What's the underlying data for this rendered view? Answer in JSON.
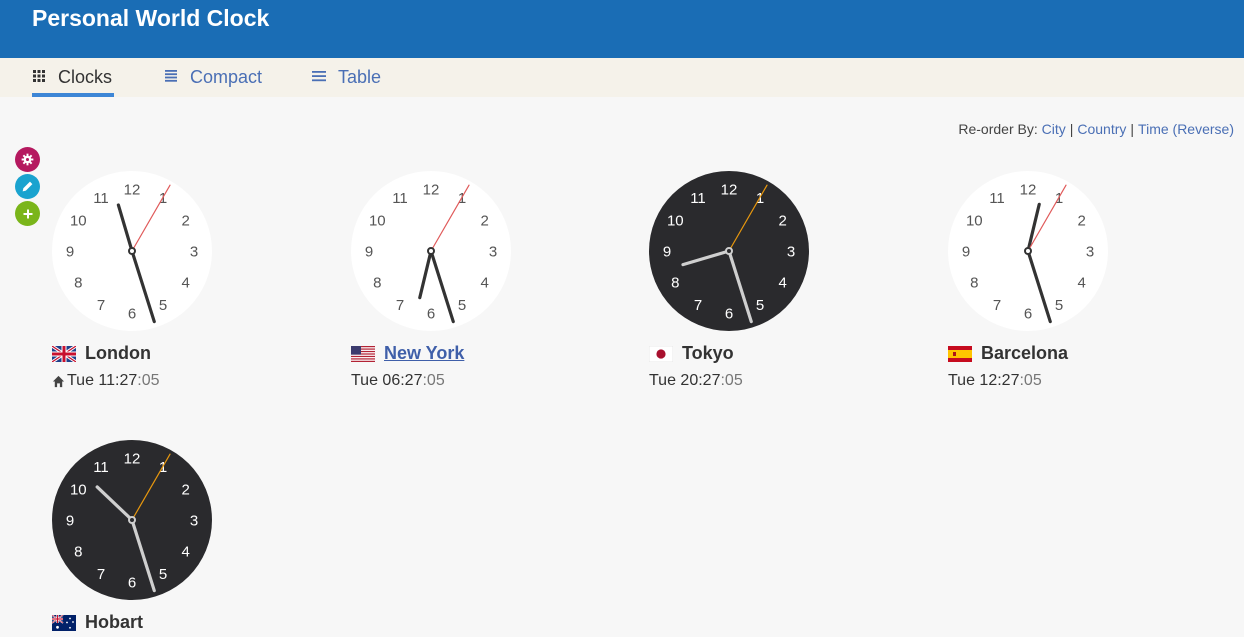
{
  "app": {
    "title": "Personal World Clock"
  },
  "tabs": [
    {
      "label": "Clocks",
      "icon": "grid-icon",
      "active": true
    },
    {
      "label": "Compact",
      "icon": "compact-list-icon",
      "active": false
    },
    {
      "label": "Table",
      "icon": "table-list-icon",
      "active": false
    }
  ],
  "reorder": {
    "prefix": "Re-order By:",
    "city": "City",
    "country": "Country",
    "time": "Time",
    "reverse": "(Reverse)",
    "sep": "|"
  },
  "side_buttons": [
    {
      "name": "settings-button",
      "icon": "gear-icon",
      "color": "#b5195f"
    },
    {
      "name": "edit-button",
      "icon": "pencil-icon",
      "color": "#1aa3cf"
    },
    {
      "name": "add-button",
      "icon": "plus-icon",
      "color": "#7ab51a"
    }
  ],
  "clocks": [
    {
      "city": "London",
      "flag": "uk-flag-icon",
      "day_time": "Tue 11:27",
      "seconds": ":05",
      "home": true,
      "link": false,
      "theme": "light",
      "hour": 11,
      "minute": 27,
      "second": 5
    },
    {
      "city": "New York",
      "flag": "us-flag-icon",
      "day_time": "Tue 06:27",
      "seconds": ":05",
      "home": false,
      "link": true,
      "theme": "light",
      "hour": 6,
      "minute": 27,
      "second": 5
    },
    {
      "city": "Tokyo",
      "flag": "japan-flag-icon",
      "day_time": "Tue 20:27",
      "seconds": ":05",
      "home": false,
      "link": false,
      "theme": "dark",
      "hour": 20,
      "minute": 27,
      "second": 5
    },
    {
      "city": "Barcelona",
      "flag": "spain-flag-icon",
      "day_time": "Tue 12:27",
      "seconds": ":05",
      "home": false,
      "link": false,
      "theme": "light",
      "hour": 12,
      "minute": 27,
      "second": 5
    },
    {
      "city": "Hobart",
      "flag": "australia-flag-icon",
      "day_time": "",
      "seconds": "",
      "home": false,
      "link": false,
      "theme": "dark",
      "hour": 22,
      "minute": 27,
      "second": 5
    }
  ],
  "colors": {
    "header": "#1a6db5",
    "link": "#4a6fb5",
    "light_second_hand": "#e05a5a",
    "dark_second_hand": "#e8980e"
  }
}
